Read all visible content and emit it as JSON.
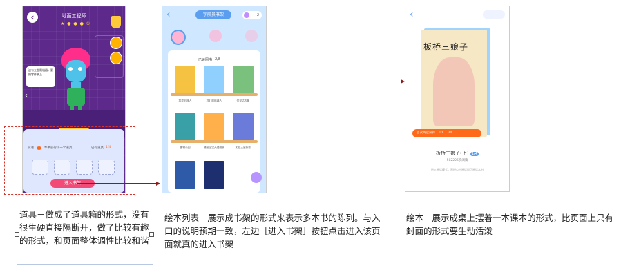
{
  "screen1": {
    "title": "地面工程师",
    "stars": "★ ● ● ● ①",
    "bubble_text": "这有五金属机器，要把零件装上",
    "toolbox": {
      "left_label": "前进",
      "badge": "1",
      "middle_label": "本书获得下一个道具",
      "right_label": "已得道具",
      "right_count": "1/4",
      "enter_button": "进入书架"
    }
  },
  "screen2": {
    "header_title": "字航员书架",
    "coin_count": "2",
    "shelf_label": "已读图书",
    "shelf_count": "2/8",
    "books": [
      {
        "title": "我是机器人",
        "color": "#f5c242"
      },
      {
        "title": "我们的机器人",
        "color": "#8fd0ff"
      },
      {
        "title": "会说话大象",
        "color": "#7bc17e"
      },
      {
        "title": "植物公园",
        "color": "#3aa0a8"
      },
      {
        "title": "播报宝宝天使电视",
        "color": "#ffb04a"
      },
      {
        "title": "太空王星探索",
        "color": "#6a7bd9"
      },
      {
        "title": "",
        "color": "#2f5aa8"
      },
      {
        "title": "",
        "color": "#1d2f6e"
      }
    ]
  },
  "screen3": {
    "cover_title": "板桥三娘子",
    "progress_text": "首次阅读获得",
    "reward_a": "10",
    "reward_b": "20",
    "book_name": "板桥三娘子(上)",
    "book_tag": "1/4",
    "book_sub": "582226次阅读",
    "book_hint": "进入阅读模式，直接点击阅读即可阅读本书"
  },
  "captions": {
    "c1": "道具－做成了道具箱的形式，没有很生硬直接隔断开，做了比较有趣的形式，和页面整体调性比较和谐",
    "c2": "绘本列表－展示成书架的形式来表示多本书的陈列。与入口的说明预期一致，左边［进入书架］按钮点击进入该页面就真的进入书架",
    "c3": "绘本－展示成桌上摆着一本课本的形式，比页面上只有封面的形式要生动活泼"
  },
  "colors": {
    "annotation_arrow": "#8b1a1a",
    "dashed_box": "#d9342b",
    "purple_bg": "#5d2a8c",
    "blue_bg": "#cfe8ff",
    "pink_button": "#f24b78"
  },
  "icons": [
    "back-icon",
    "cup-icon",
    "trophy-icon",
    "coin-icon",
    "avatar-icon",
    "fab-icon"
  ]
}
